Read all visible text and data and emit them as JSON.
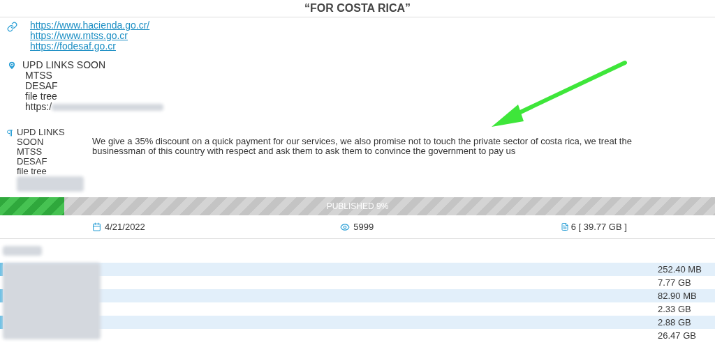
{
  "title": "“FOR COSTA RICA”",
  "links": [
    "https://www.hacienda.go.cr/",
    "https://www.mtss.go.cr",
    "https://fodesaf.go.cr"
  ],
  "location_block": {
    "lines": [
      "UPD LINKS SOON",
      "MTSS",
      "DESAF",
      "file tree",
      "https:/"
    ]
  },
  "notes_block": {
    "lines": [
      "UPD LINKS",
      "SOON",
      "MTSS",
      "DESAF",
      "file tree"
    ]
  },
  "message": "We give a 35% discount on a quick payment for our services, we also promise not to touch the private sector of costa rica, we treat the businessman of this country with respect and ask them to ask them to convince the government to pay us",
  "progress": {
    "label": "PUBLISHED 9%",
    "level": 0.09
  },
  "stats": {
    "date": "4/21/2022",
    "views": "5999",
    "files": "6 [ 39.77 GB ]"
  },
  "files": [
    {
      "size": "252.40 MB"
    },
    {
      "size": "7.77 GB"
    },
    {
      "size": "82.90 MB"
    },
    {
      "size": "2.33 GB"
    },
    {
      "size": "2.88 GB"
    },
    {
      "size": "26.47 GB"
    }
  ]
}
